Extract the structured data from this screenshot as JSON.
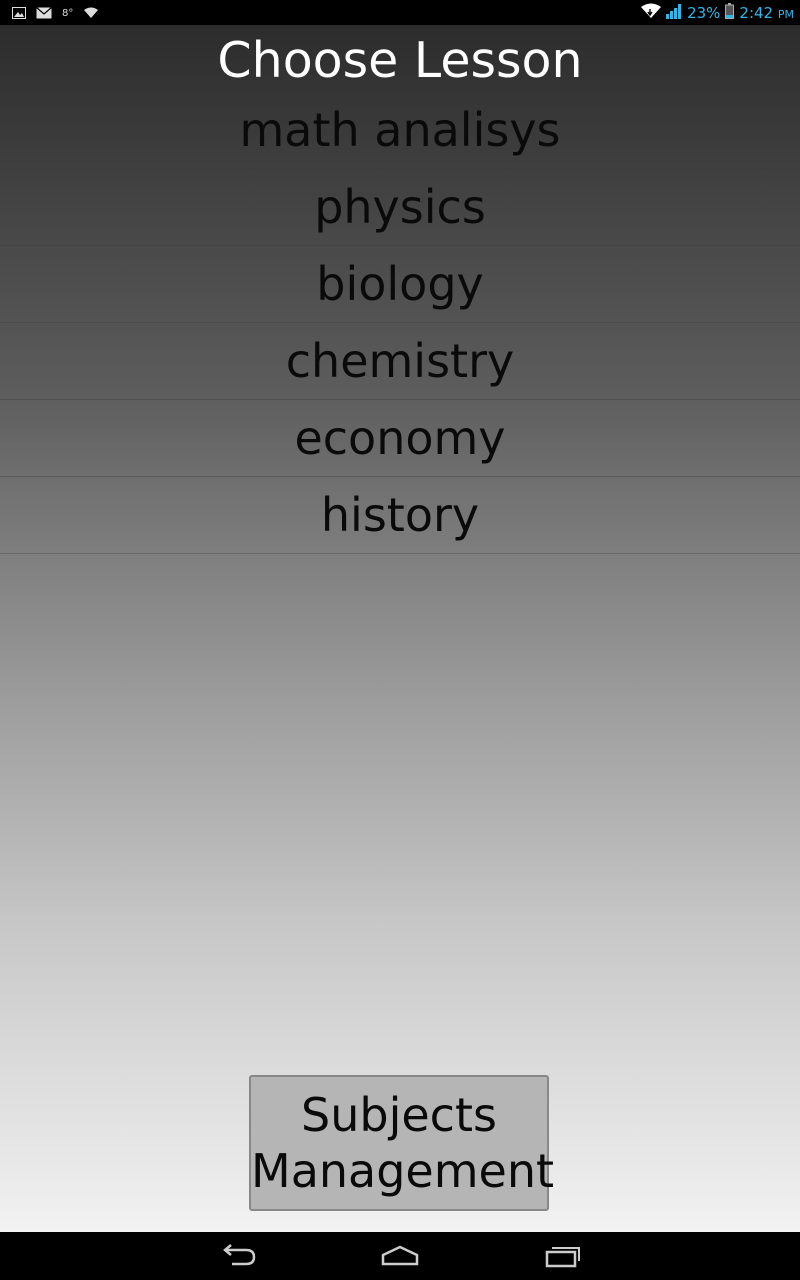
{
  "status_bar": {
    "left_icons": [
      "gallery-notification-icon",
      "mail-notification-icon",
      "temperature-notification-icon",
      "wifi-notification-icon"
    ],
    "temperature": "8°",
    "battery_percent": "23%",
    "time": "2:42",
    "ampm": "PM",
    "accent_color": "#33b5e5"
  },
  "screen": {
    "title": "Choose Lesson",
    "lessons": [
      {
        "label": "math analisys"
      },
      {
        "label": "physics"
      },
      {
        "label": "biology"
      },
      {
        "label": "chemistry"
      },
      {
        "label": "economy"
      },
      {
        "label": "history"
      }
    ],
    "subjects_button": {
      "line1": "Subjects",
      "line2": "Management"
    }
  },
  "nav_bar": {
    "buttons": [
      "back-icon",
      "home-icon",
      "recent-apps-icon"
    ]
  }
}
